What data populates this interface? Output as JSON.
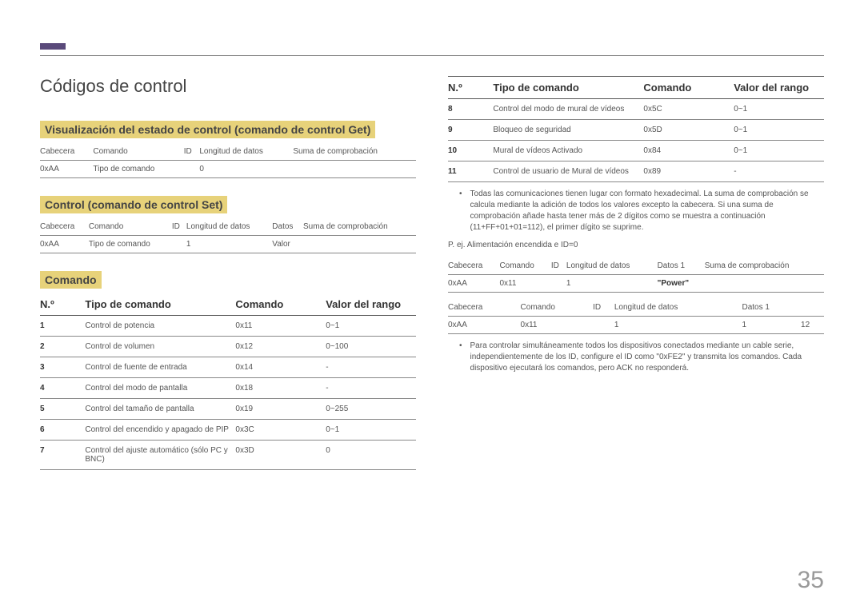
{
  "page_number": "35",
  "h1": "Códigos de control",
  "sections": {
    "get": {
      "title": "Visualización del estado de control (comando de control Get)",
      "headers": [
        "Cabecera",
        "Comando",
        "ID",
        "Longitud de datos",
        "Suma de comprobación"
      ],
      "row": [
        "0xAA",
        "Tipo de comando",
        "",
        "0",
        ""
      ]
    },
    "set": {
      "title": "Control (comando de control Set)",
      "headers": [
        "Cabecera",
        "Comando",
        "ID",
        "Longitud de datos",
        "Datos",
        "Suma de comprobación"
      ],
      "row": [
        "0xAA",
        "Tipo de comando",
        "",
        "1",
        "Valor",
        ""
      ]
    },
    "comando_title": "Comando",
    "cmd_headers": {
      "no": "N.º",
      "tipo": "Tipo de comando",
      "cmd": "Comando",
      "rango": "Valor del rango"
    },
    "commands_left": [
      {
        "no": "1",
        "tipo": "Control de potencia",
        "cmd": "0x11",
        "rango": "0~1"
      },
      {
        "no": "2",
        "tipo": "Control de volumen",
        "cmd": "0x12",
        "rango": "0~100"
      },
      {
        "no": "3",
        "tipo": "Control de fuente de entrada",
        "cmd": "0x14",
        "rango": "-"
      },
      {
        "no": "4",
        "tipo": "Control del modo de pantalla",
        "cmd": "0x18",
        "rango": "-"
      },
      {
        "no": "5",
        "tipo": "Control del tamaño de pantalla",
        "cmd": "0x19",
        "rango": "0~255"
      },
      {
        "no": "6",
        "tipo": "Control del encendido y apagado de PIP",
        "cmd": "0x3C",
        "rango": "0~1"
      },
      {
        "no": "7",
        "tipo": "Control del ajuste automático (sólo PC y BNC)",
        "cmd": "0x3D",
        "rango": "0"
      }
    ],
    "commands_right": [
      {
        "no": "8",
        "tipo": "Control del modo de mural de vídeos",
        "cmd": "0x5C",
        "rango": "0~1"
      },
      {
        "no": "9",
        "tipo": "Bloqueo de seguridad",
        "cmd": "0x5D",
        "rango": "0~1"
      },
      {
        "no": "10",
        "tipo": "Mural de vídeos Activado",
        "cmd": "0x84",
        "rango": "0~1"
      },
      {
        "no": "11",
        "tipo": "Control de usuario de Mural de vídeos",
        "cmd": "0x89",
        "rango": "-"
      }
    ],
    "note1": "Todas las comunicaciones tienen lugar con formato hexadecimal. La suma de comprobación se calcula mediante la adición de todos los valores excepto la cabecera. Si una suma de comprobación añade hasta tener más de 2 dígitos como se muestra a continuación (11+FF+01+01=112), el primer dígito se suprime.",
    "example_label": "P. ej. Alimentación encendida e ID=0",
    "ex1_headers": [
      "Cabecera",
      "Comando",
      "ID",
      "Longitud de datos",
      "Datos 1",
      "Suma de comprobación"
    ],
    "ex1_row": [
      "0xAA",
      "0x11",
      "",
      "1",
      "\"Power\"",
      ""
    ],
    "ex2_headers": [
      "Cabecera",
      "Comando",
      "ID",
      "Longitud de datos",
      "Datos 1",
      ""
    ],
    "ex2_row": [
      "0xAA",
      "0x11",
      "",
      "1",
      "1",
      "12"
    ],
    "note2": "Para controlar simultáneamente todos los dispositivos conectados mediante un cable serie, independientemente de los ID, configure el ID como \"0xFE2\" y transmita los comandos. Cada dispositivo ejecutará los comandos, pero ACK no responderá."
  }
}
